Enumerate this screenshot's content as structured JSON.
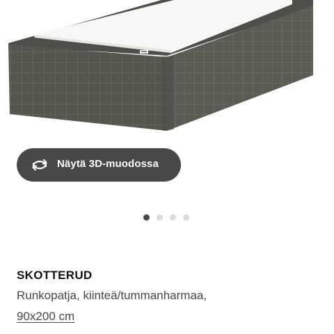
{
  "product": {
    "name": "SKOTTERUD",
    "description": "Runkopatja, kiinteä/tummanharmaa,",
    "size_link": "90x200 cm"
  },
  "gallery": {
    "view_3d_label": "Näytä 3D-muodossa",
    "view_3d_icon": "rotate-3d-icon",
    "image_count": 4,
    "active_index": 0
  },
  "colors": {
    "button_bg": "#484848",
    "fabric": "#55574f",
    "dot_active": "#484848",
    "dot_inactive": "#dcdcdc"
  }
}
